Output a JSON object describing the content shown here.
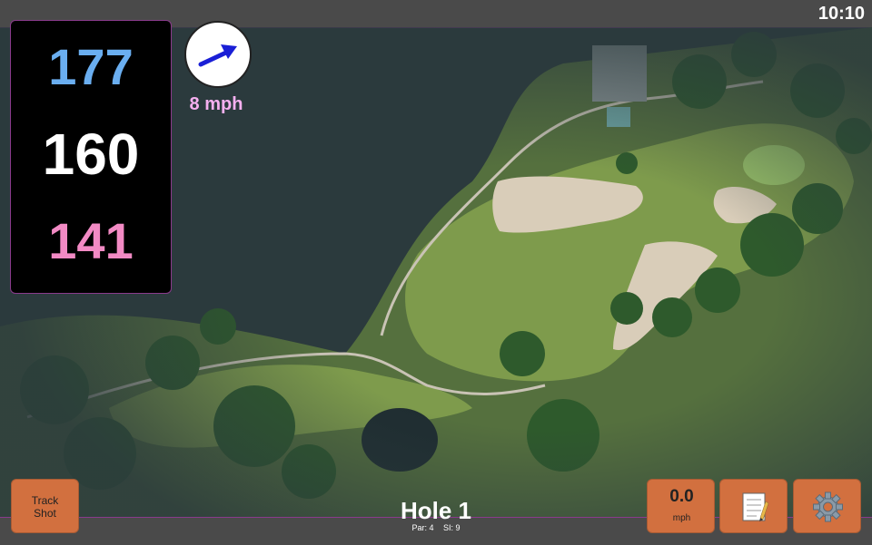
{
  "clock": "10:10",
  "distances": {
    "back": "177",
    "middle": "160",
    "front": "141"
  },
  "wind": {
    "speed": "8 mph",
    "direction_icon": "wind-arrow-icon"
  },
  "buttons": {
    "track_shot": "Track\nShot",
    "speed_value": "0.0",
    "speed_unit": "mph",
    "notes_icon": "notepad-icon",
    "settings_icon": "gear-icon"
  },
  "hole": {
    "title": "Hole 1",
    "par": "Par: 4",
    "si": "SI: 9"
  },
  "colors": {
    "back": "#6aaef0",
    "middle": "#ffffff",
    "front": "#f28ac4",
    "wind_text": "#f6b0f0",
    "button": "#d2703f",
    "accent_border": "#8a3b8c"
  }
}
